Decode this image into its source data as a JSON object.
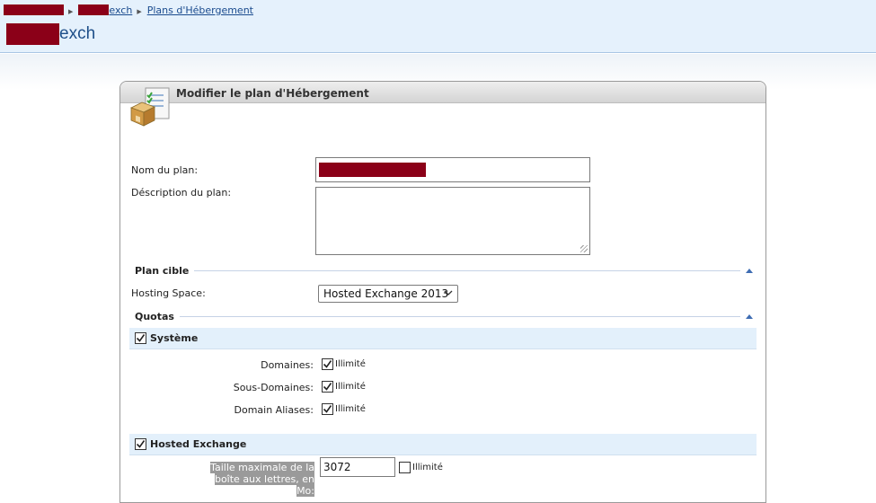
{
  "breadcrumb": {
    "item2_suffix": "exch",
    "item3": "Plans d'Hébergement"
  },
  "page": {
    "title_suffix": "exch"
  },
  "panel": {
    "title": "Modifier le plan d'Hébergement",
    "icon": "hosting-plan-package-icon"
  },
  "form": {
    "plan_name_label": "Nom du plan:",
    "plan_desc_label": "Déscription du plan:",
    "plan_desc_value": ""
  },
  "target": {
    "section_title": "Plan cible",
    "hosting_space_label": "Hosting Space:",
    "hosting_space_value": "Hosted Exchange 2013"
  },
  "quotas": {
    "section_title": "Quotas",
    "system": {
      "title": "Système",
      "checked": true,
      "rows": [
        {
          "label": "Domaines:",
          "checkbox_label": "Illimité",
          "checked": true
        },
        {
          "label": "Sous-Domaines:",
          "checkbox_label": "Illimité",
          "checked": true
        },
        {
          "label": "Domain Aliases:",
          "checkbox_label": "Illimité",
          "checked": true
        }
      ]
    },
    "exchange": {
      "title": "Hosted Exchange",
      "checked": true,
      "mailbox_label_line1": "Taille maximale de la",
      "mailbox_label_line2": "boîte aux lettres, en Mo:",
      "mailbox_value": "3072",
      "unlimited_label": "Illimité",
      "unlimited_checked": false
    }
  },
  "colors": {
    "header_bg": "#e5f1fc",
    "link": "#1a4b8e",
    "title": "#1e4f89",
    "redaction": "#8b0018",
    "group_bar": "#e3f0fb"
  }
}
